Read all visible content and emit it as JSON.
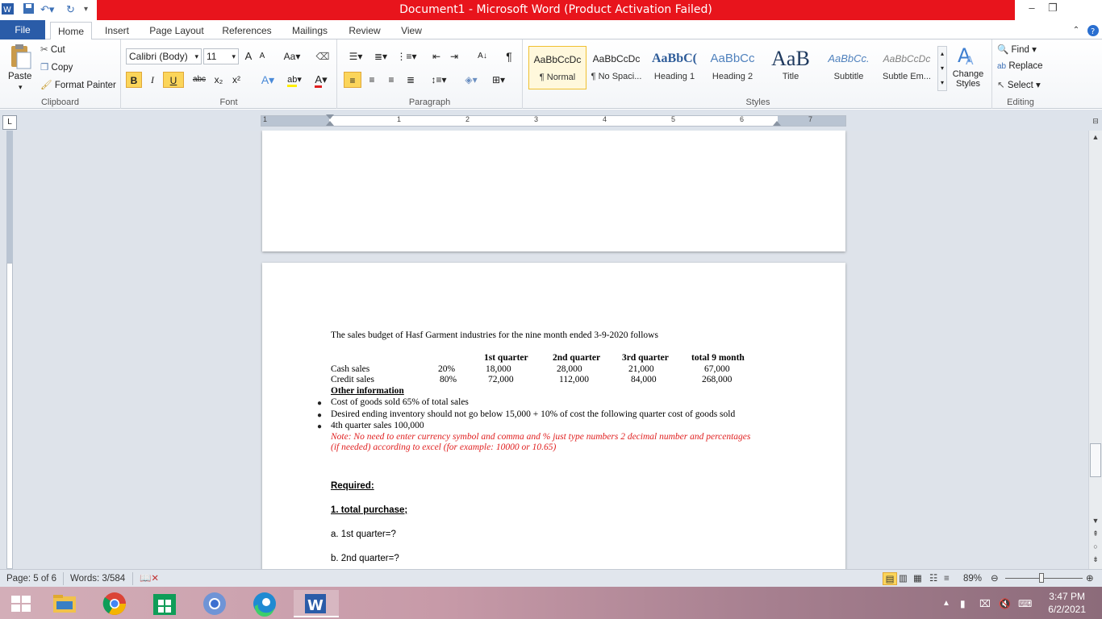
{
  "window": {
    "title": "Document1  -  Microsoft Word (Product Activation Failed)"
  },
  "tabs": {
    "file": "File",
    "items": [
      "Home",
      "Insert",
      "Page Layout",
      "References",
      "Mailings",
      "Review",
      "View"
    ]
  },
  "clipboard": {
    "paste": "Paste",
    "cut": "Cut",
    "copy": "Copy",
    "format_painter": "Format Painter",
    "label": "Clipboard"
  },
  "font": {
    "name": "Calibri (Body)",
    "size": "11",
    "label": "Font",
    "bold": "B",
    "italic": "I",
    "underline": "U",
    "strike": "abc",
    "subscript": "x₂",
    "superscript": "x²",
    "grow": "A",
    "shrink": "A",
    "case": "Aa"
  },
  "paragraph": {
    "label": "Paragraph"
  },
  "styles": {
    "label": "Styles",
    "items": [
      {
        "sample": "AaBbCcDc",
        "name": "¶ Normal"
      },
      {
        "sample": "AaBbCcDc",
        "name": "¶ No Spaci..."
      },
      {
        "sample": "AaBbC(",
        "name": "Heading 1"
      },
      {
        "sample": "AaBbCc",
        "name": "Heading 2"
      },
      {
        "sample": "AaB",
        "name": "Title"
      },
      {
        "sample": "AaBbCc.",
        "name": "Subtitle"
      },
      {
        "sample": "AaBbCcDc",
        "name": "Subtle Em..."
      }
    ],
    "change_styles": "Change Styles"
  },
  "editing": {
    "label": "Editing",
    "find": "Find",
    "replace": "Replace",
    "select": "Select"
  },
  "ruler": {
    "numbers": [
      "1",
      "1",
      "2",
      "3",
      "4",
      "5",
      "6",
      "7"
    ]
  },
  "document": {
    "intro": "The sales budget of Hasf Garment industries for the nine month ended 3-9-2020 follows",
    "table": {
      "headers": [
        "1st quarter",
        "2nd quarter",
        "3rd quarter",
        "total 9 month"
      ],
      "rows": [
        {
          "label": "Cash sales",
          "pct": "20%",
          "values": [
            "18,000",
            "28,000",
            "21,000",
            "67,000"
          ]
        },
        {
          "label": "Credit sales",
          "pct": "80%",
          "values": [
            "72,000",
            "112,000",
            "84,000",
            "268,000"
          ]
        }
      ]
    },
    "other_info_heading": "Other information",
    "bullets": [
      "Cost of goods sold 65% of total  sales",
      "Desired ending inventory should not go below 15,000 + 10% of cost the following quarter cost of goods sold",
      "4th quarter sales 100,000"
    ],
    "note_line1": "Note: No need to enter currency symbol and comma and % just type numbers 2 decimal number and percentages",
    "note_line2": "(if needed) according to excel (for example: 10000 or 10.65)",
    "required": "Required:",
    "q1_title": "1. total purchase;",
    "q1a": "a. 1st quarter=?",
    "q1b": "b. 2nd quarter=?"
  },
  "status": {
    "page": "Page: 5 of 6",
    "words": "Words: 3/584",
    "zoom": "89%"
  },
  "taskbar": {
    "time": "3:47 PM",
    "date": "6/2/2021"
  },
  "colors": {
    "title_bar_red": "#e8141c",
    "file_tab_blue": "#2a5ca8",
    "note_red": "#e02020"
  }
}
